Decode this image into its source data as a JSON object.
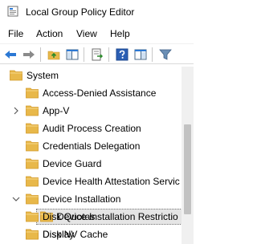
{
  "window": {
    "title": "Local Group Policy Editor",
    "icon": "policy-editor-icon"
  },
  "menu": {
    "items": [
      "File",
      "Action",
      "View",
      "Help"
    ]
  },
  "toolbar": {
    "buttons": [
      {
        "name": "back",
        "icon": "arrow-left-icon"
      },
      {
        "name": "forward",
        "icon": "arrow-right-icon"
      },
      {
        "name": "up-one-level",
        "icon": "folder-up-icon"
      },
      {
        "name": "show-hide-console-tree",
        "icon": "console-tree-icon"
      },
      {
        "name": "export-list",
        "icon": "export-list-icon"
      },
      {
        "name": "help",
        "icon": "help-icon"
      },
      {
        "name": "show-hide-action-pane",
        "icon": "action-pane-icon"
      },
      {
        "name": "filter",
        "icon": "filter-icon"
      }
    ]
  },
  "tree": {
    "items": [
      {
        "label": "System",
        "expander": "expanded"
      },
      {
        "label": "Access-Denied Assistance",
        "expander": "none"
      },
      {
        "label": "App-V",
        "expander": "collapsed"
      },
      {
        "label": "Audit Process Creation",
        "expander": "none"
      },
      {
        "label": "Credentials Delegation",
        "expander": "none"
      },
      {
        "label": "Device Guard",
        "expander": "none"
      },
      {
        "label": "Device Health Attestation Servic",
        "expander": "none"
      },
      {
        "label": "Device Installation",
        "expander": "expanded"
      },
      {
        "label": "Device Installation Restrictio",
        "expander": "none",
        "selected": true
      },
      {
        "label": "Disk NV Cache",
        "expander": "none"
      },
      {
        "label": "Disk Quotas",
        "expander": "none"
      },
      {
        "label": "Display",
        "expander": "none"
      }
    ]
  },
  "colors": {
    "folder": "#e8b84a",
    "folder_dark": "#d39a2a",
    "accent_blue": "#2b78d4",
    "selection": "#e5e5e5",
    "scrollbar_thumb": "#c2c2c2"
  }
}
